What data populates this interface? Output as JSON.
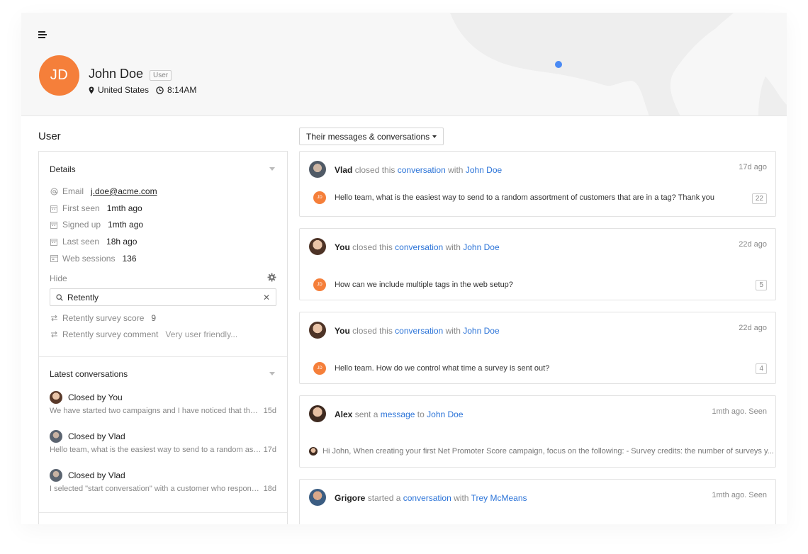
{
  "colors": {
    "accent": "#f57f3a",
    "link": "#2c74d8",
    "map_dot": "#4a8af4"
  },
  "header": {
    "avatar_initials": "JD",
    "name": "John Doe",
    "role": "User",
    "location": "United States",
    "local_time": "8:14AM"
  },
  "left": {
    "section_title": "User",
    "details": {
      "title": "Details",
      "attributes": [
        {
          "icon": "at-icon",
          "label": "Email",
          "value": "j.doe@acme.com"
        },
        {
          "icon": "calendar-icon",
          "label": "First seen",
          "value": "1mth ago"
        },
        {
          "icon": "calendar-icon",
          "label": "Signed up",
          "value": "1mth ago"
        },
        {
          "icon": "calendar-icon",
          "label": "Last seen",
          "value": "18h ago"
        },
        {
          "icon": "browser-icon",
          "label": "Web sessions",
          "value": "136"
        }
      ],
      "hide_label": "Hide",
      "search_value": "Retently",
      "integrations": [
        {
          "icon": "swap-icon",
          "label": "Retently survey score",
          "value": "9"
        },
        {
          "icon": "swap-icon",
          "label": "Retently survey comment",
          "value": "Very user friendly..."
        }
      ]
    },
    "latest": {
      "title": "Latest conversations",
      "items": [
        {
          "title": "Closed by You",
          "snippet": "We have started two campaigns and I have noticed that the S...",
          "ago": "15d"
        },
        {
          "title": "Closed by Vlad",
          "snippet": "Hello team, what is the easiest way to send to a random assor...",
          "ago": "17d"
        },
        {
          "title": "Closed by Vlad",
          "snippet": "I selected \"start conversation\" with a customer who responde...",
          "ago": "18d"
        }
      ]
    }
  },
  "right": {
    "filter_label": "Their messages & conversations",
    "cards": [
      {
        "actor": "Vlad",
        "verb": "closed this",
        "object": "conversation",
        "prep": "with",
        "target": "John Doe",
        "time": "17d ago",
        "body": "Hello team, what is the easiest way to send to a random assortment of customers that are in a tag? Thank you",
        "count": "22",
        "body_avatar": "JD"
      },
      {
        "actor": "You",
        "verb": "closed this",
        "object": "conversation",
        "prep": "with",
        "target": "John Doe",
        "time": "22d ago",
        "body": "How can we include multiple tags in the web setup?",
        "count": "5",
        "body_avatar": "JD"
      },
      {
        "actor": "You",
        "verb": "closed this",
        "object": "conversation",
        "prep": "with",
        "target": "John Doe",
        "time": "22d ago",
        "body": "Hello team. How do we control what time a survey is sent out?",
        "count": "4",
        "body_avatar": "JD"
      },
      {
        "actor": "Alex",
        "verb": "sent a",
        "object": "message",
        "prep": "to",
        "target": "John Doe",
        "time": "1mth ago. Seen",
        "body": "Hi John, When creating your first Net Promoter Score campaign, focus on the following: - Survey credits: the number of surveys y..."
      },
      {
        "actor": "Grigore",
        "verb": "started a",
        "object": "conversation",
        "prep": "with",
        "target": "Trey McMeans",
        "time": "1mth ago. Seen"
      }
    ]
  }
}
